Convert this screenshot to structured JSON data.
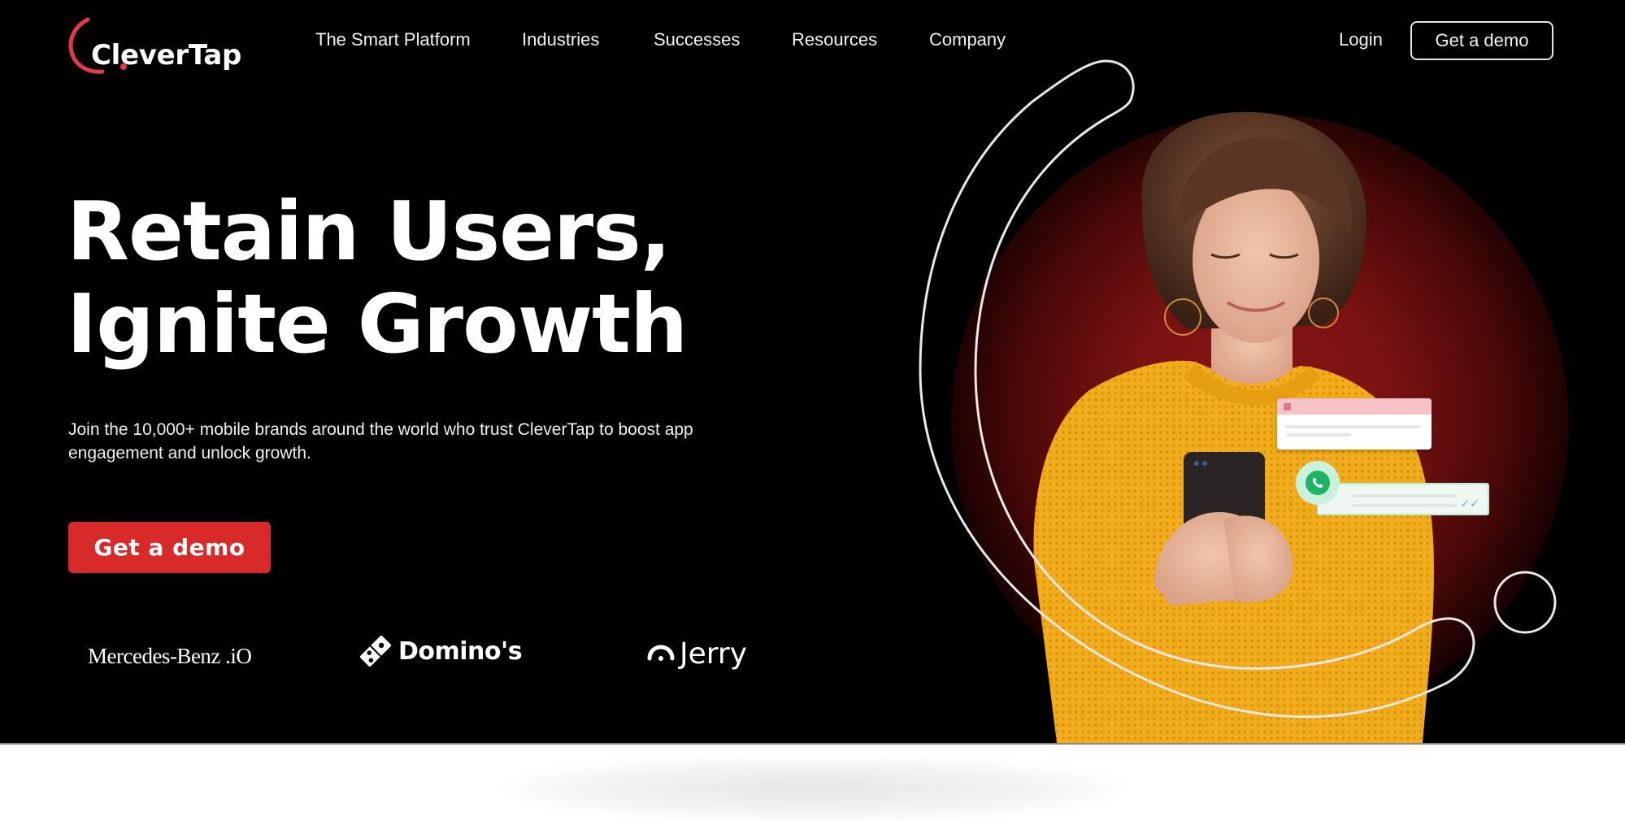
{
  "brand": {
    "name": "CleverTap",
    "accent_color": "#d92a2a",
    "logo_arc_color": "#e63946"
  },
  "nav": {
    "items": [
      {
        "label": "The Smart Platform"
      },
      {
        "label": "Industries"
      },
      {
        "label": "Successes"
      },
      {
        "label": "Resources"
      },
      {
        "label": "Company"
      }
    ],
    "login_label": "Login",
    "demo_label": "Get a demo"
  },
  "hero": {
    "headline_line1": "Retain Users,",
    "headline_line2": "Ignite Growth",
    "subtext": "Join the 10,000+ mobile brands around the world who trust CleverTap to boost app engagement and unlock growth.",
    "cta_label": "Get a demo",
    "background_color": "#000000",
    "glow_color": "#8a1414"
  },
  "clients": [
    {
      "name": "Mercedes-Benz .io",
      "label": "Mercedes-Benz .iO",
      "icon": "none"
    },
    {
      "name": "Domino's",
      "label": "Domino's",
      "icon": "domino-tile-icon"
    },
    {
      "name": "Jerry",
      "label": "Jerry",
      "icon": "jerry-arc-icon"
    }
  ],
  "visual": {
    "notification_card_icon": "notification-card-icon",
    "whatsapp_icon": "whatsapp-icon",
    "message_ticks": "✓✓",
    "person_description": "woman in yellow sweater looking at phone"
  }
}
